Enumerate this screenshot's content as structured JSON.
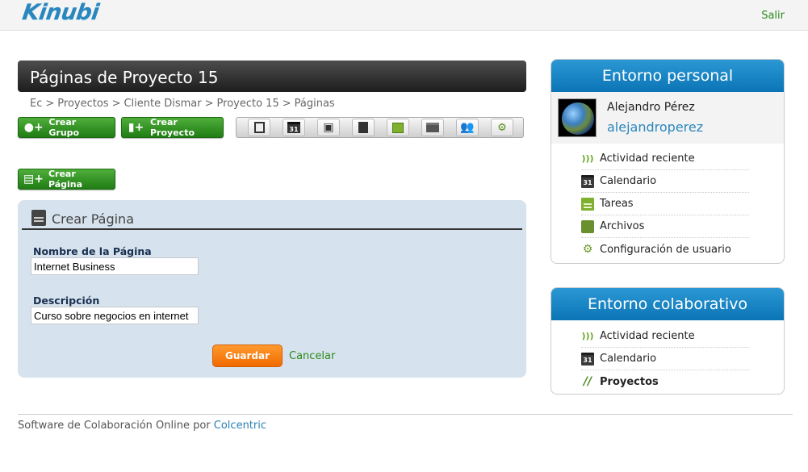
{
  "brand": {
    "logo_text": "Kinubi"
  },
  "header": {
    "logout": "Salir"
  },
  "page": {
    "title": "Páginas de Proyecto 15",
    "breadcrumb": [
      "Ec",
      "Proyectos",
      "Cliente Dismar",
      "Proyecto 15",
      "Páginas"
    ]
  },
  "actions": {
    "crear_grupo": "Crear Grupo",
    "crear_proyecto": "Crear Proyecto",
    "crear_pagina": "Crear Página"
  },
  "tools": [
    {
      "icon": "page-icon"
    },
    {
      "icon": "calendar-icon",
      "text": "31"
    },
    {
      "icon": "chat-icon"
    },
    {
      "icon": "note-icon"
    },
    {
      "icon": "tasks-icon"
    },
    {
      "icon": "folder-icon"
    },
    {
      "icon": "users-icon"
    },
    {
      "icon": "settings-icon"
    }
  ],
  "form": {
    "heading": "Crear Página",
    "name_label": "Nombre de la Página",
    "name_value": "Internet Business",
    "desc_label": "Descripción",
    "desc_value": "Curso sobre negocios en internet",
    "save": "Guardar",
    "cancel": "Cancelar"
  },
  "footer": {
    "text": "Software de Colaboración Online por ",
    "link": "Colcentric"
  },
  "personal": {
    "title": "Entorno personal",
    "user_name": "Alejandro Pérez",
    "username": "alejandroperez",
    "items": [
      {
        "label": "Actividad reciente",
        "icon": "rss-icon"
      },
      {
        "label": "Calendario",
        "icon": "calendar-icon",
        "icon_text": "31"
      },
      {
        "label": "Tareas",
        "icon": "tasks-icon"
      },
      {
        "label": "Archivos",
        "icon": "folder-icon"
      },
      {
        "label": "Configuración de usuario",
        "icon": "settings-icon"
      }
    ]
  },
  "collab": {
    "title": "Entorno colaborativo",
    "items": [
      {
        "label": "Actividad reciente",
        "icon": "rss-icon"
      },
      {
        "label": "Calendario",
        "icon": "calendar-icon",
        "icon_text": "31"
      },
      {
        "label": "Proyectos",
        "icon": "projects-icon",
        "active": true
      }
    ]
  },
  "colors": {
    "brand_blue": "#2a86bd",
    "green": "#2d8a1d",
    "orange": "#f06a00",
    "panel_bg": "#d6e2ed"
  }
}
